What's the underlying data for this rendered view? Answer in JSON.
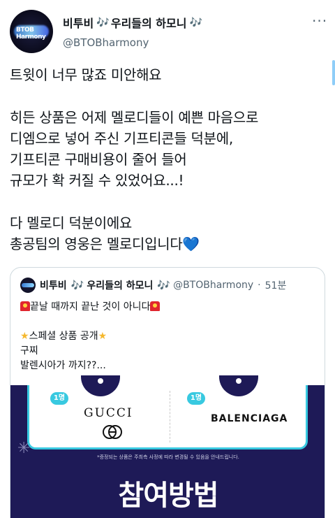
{
  "tweet": {
    "author_name": "비투비",
    "author_suffix": "우리들의 하모니",
    "note_glyph": "🎶",
    "handle": "@BTOBharmony",
    "more_glyph": "···",
    "avatar_logo": "BTOB Harmony",
    "text": "트윗이 너무 많죠 미안해요\n\n히든 상품은 어제 멜로디들이 예쁜 마음으로\n디엠으로 넣어 주신 기프티콘들 덕분에,\n기프티콘 구매비용이 줄어 들어\n규모가 확 커질 수 있었어요...!\n\n다 멜로디 덕분이에요\n총공팀의 영웅은 멜로디입니다",
    "heart": "💙"
  },
  "quote": {
    "author_name": "비투비",
    "author_suffix": "우리들의 하모니",
    "handle": "@BTOBharmony",
    "dot": "·",
    "time": "51분",
    "line1": "끝날 때까지 끝난 것이 아니다",
    "line2_text": "스페셜 상품 공개",
    "line3": "구찌",
    "line4": "발렌시아가 까지??..."
  },
  "promo": {
    "badge_left": "1명",
    "badge_right": "1명",
    "brand_left": "GUCCI",
    "brand_right": "BALENCIAGA",
    "notice": "*증정되는 상품은 주최측 사정에 따라 변경될 수 있음을 안내드립니다.",
    "title": "참여방법"
  },
  "colors": {
    "accent": "#1d9bf0",
    "promo_bg": "#1e1a57",
    "promo_border": "#38c9e0"
  }
}
